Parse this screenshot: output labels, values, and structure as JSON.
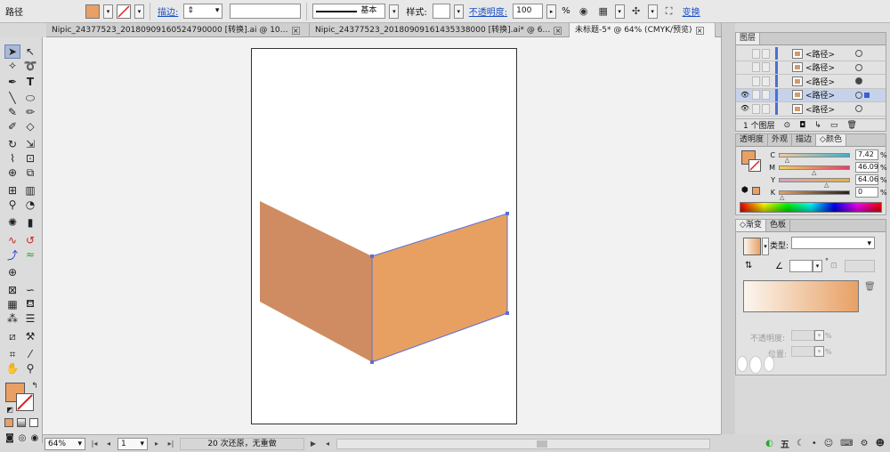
{
  "control_bar": {
    "object_type": "路径",
    "fill_color": "#e8a064",
    "stroke_label": "描边:",
    "stroke_profile": "基本",
    "style_label": "样式:",
    "opacity_label": "不透明度:",
    "opacity_value": "100",
    "opacity_unit": "%",
    "transform_label": "变换"
  },
  "tabs": [
    {
      "label": "Nipic_24377523_20180909160524790000 [转换].ai @ 10…",
      "active": false
    },
    {
      "label": "Nipic_24377523_20180909161435338000 [转换].ai* @ 6…",
      "active": false
    },
    {
      "label": "未标题-5* @ 64% (CMYK/预览)",
      "active": true
    }
  ],
  "artwork": {
    "left_face_color": "#cf8c62",
    "right_face_color": "#e8a062",
    "selection_color": "#5a6fd6"
  },
  "status_bar": {
    "zoom": "64%",
    "artboard_number": "1",
    "undo_text": "20 次还原，无重做"
  },
  "layers_panel": {
    "title": "图层",
    "rows": [
      {
        "name": "<路径>",
        "selected": false,
        "eye": false,
        "target_filled": false
      },
      {
        "name": "<路径>",
        "selected": false,
        "eye": false,
        "target_filled": false
      },
      {
        "name": "<路径>",
        "selected": false,
        "eye": false,
        "target_filled": true
      },
      {
        "name": "<路径>",
        "selected": true,
        "eye": true,
        "target_filled": false
      },
      {
        "name": "<路径>",
        "selected": false,
        "eye": true,
        "target_filled": false
      }
    ],
    "footer": "1 个图层"
  },
  "color_panel": {
    "tabs": [
      "透明度",
      "外观",
      "描边",
      "颜色"
    ],
    "active_tab": "颜色",
    "fill_color": "#e8a064",
    "channels": [
      {
        "name": "C",
        "value": "7.42",
        "gradient": [
          "#f5c9a0",
          "#3cb0c8"
        ]
      },
      {
        "name": "M",
        "value": "46.09",
        "gradient": [
          "#f0d060",
          "#e0406a"
        ]
      },
      {
        "name": "Y",
        "value": "64.06",
        "gradient": [
          "#d4a0c8",
          "#e8b040"
        ]
      },
      {
        "name": "K",
        "value": "0",
        "gradient": [
          "#e8a064",
          "#222222"
        ]
      }
    ],
    "unit": "%",
    "levels": {
      "C": 0.0742,
      "M": 0.4609,
      "Y": 0.6406,
      "K": 0.0
    }
  },
  "gradient_panel": {
    "tabs": [
      "渐变",
      "色板"
    ],
    "active_tab": "渐变",
    "type_label": "类型:",
    "opacity_label": "不透明度:",
    "location_label": "位置:",
    "unit": "%",
    "start_color": "#fbf6ef",
    "end_color": "#e8a064"
  },
  "tray": {
    "ime_label": "五"
  }
}
